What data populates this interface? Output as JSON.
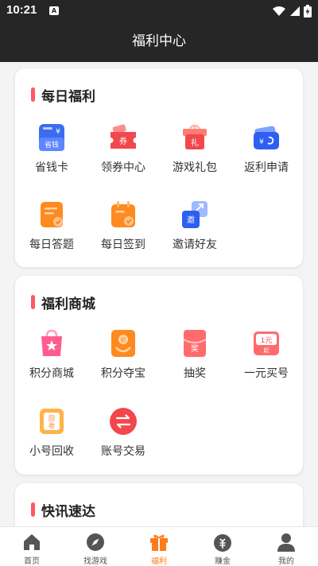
{
  "status": {
    "time": "10:21",
    "notif_glyph": "A"
  },
  "page": {
    "title": "福利中心"
  },
  "colors": {
    "accent": "#ff7a1a",
    "section_bar": "#ff5a5f",
    "header_bg": "#262626"
  },
  "daily": {
    "title": "每日福利",
    "items": [
      {
        "label": "省钱卡",
        "icon": "savings-card-icon",
        "badge": "省钱"
      },
      {
        "label": "领券中心",
        "icon": "coupon-icon",
        "badge": "券"
      },
      {
        "label": "游戏礼包",
        "icon": "gift-pack-icon",
        "badge": "礼"
      },
      {
        "label": "返利申请",
        "icon": "rebate-icon"
      },
      {
        "label": "每日答题",
        "icon": "daily-quiz-icon"
      },
      {
        "label": "每日签到",
        "icon": "check-in-icon"
      },
      {
        "label": "邀请好友",
        "icon": "invite-icon",
        "badge": "邀"
      }
    ]
  },
  "mall": {
    "title": "福利商城",
    "items": [
      {
        "label": "积分商城",
        "icon": "points-mall-icon"
      },
      {
        "label": "积分夺宝",
        "icon": "treasure-icon",
        "badge": "积"
      },
      {
        "label": "抽奖",
        "icon": "lottery-icon",
        "badge": "奖"
      },
      {
        "label": "一元买号",
        "icon": "one-yuan-icon",
        "badge": "1元",
        "badge2": "起"
      },
      {
        "label": "小号回收",
        "icon": "recycle-icon",
        "badge": "回",
        "badge2": "收"
      },
      {
        "label": "账号交易",
        "icon": "trade-icon"
      }
    ]
  },
  "news": {
    "title": "快讯速达"
  },
  "tabs": [
    {
      "label": "首页",
      "icon": "home-icon"
    },
    {
      "label": "找游戏",
      "icon": "compass-icon"
    },
    {
      "label": "福利",
      "icon": "gift-icon",
      "active": true
    },
    {
      "label": "赚金",
      "icon": "money-bag-icon"
    },
    {
      "label": "我的",
      "icon": "profile-icon"
    }
  ]
}
